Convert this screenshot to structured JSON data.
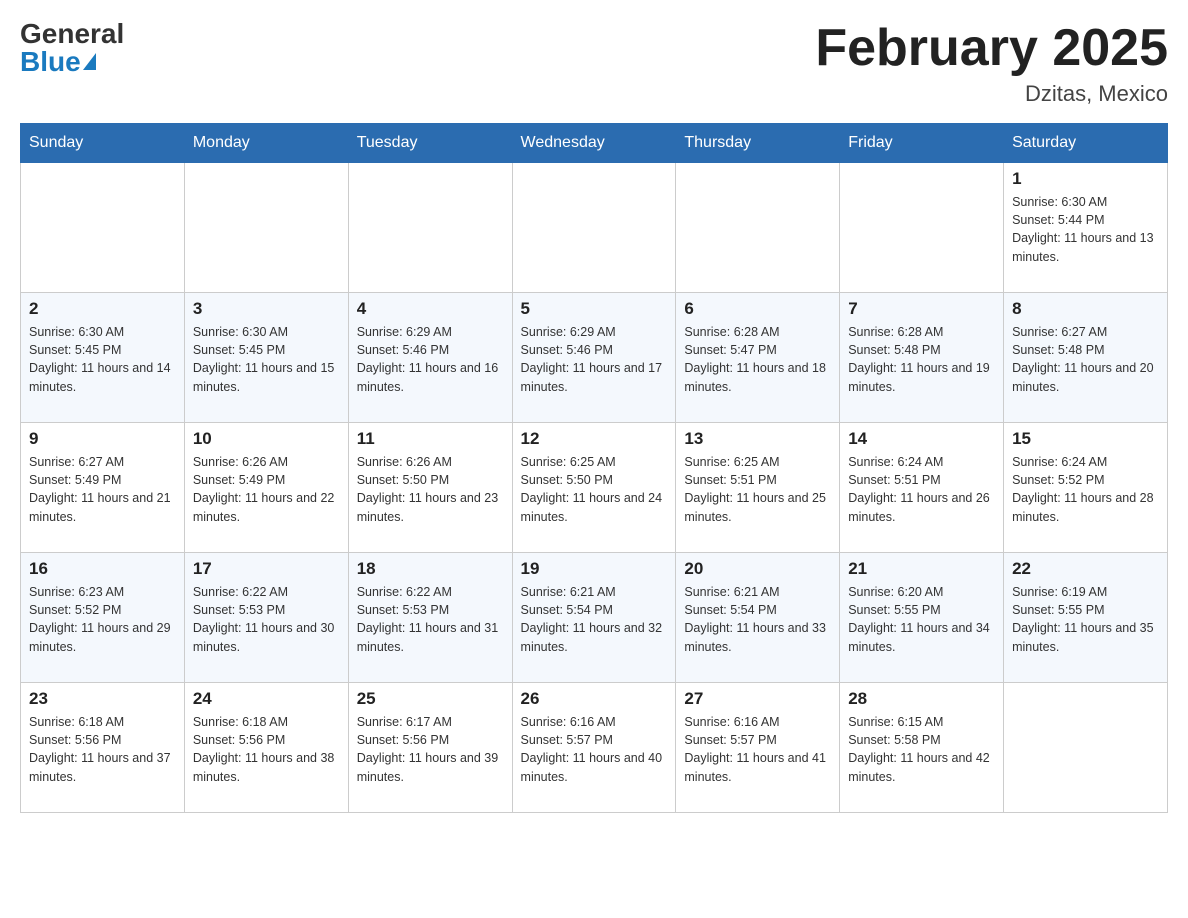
{
  "header": {
    "logo_general": "General",
    "logo_blue": "Blue",
    "month_year": "February 2025",
    "location": "Dzitas, Mexico"
  },
  "days_of_week": [
    "Sunday",
    "Monday",
    "Tuesday",
    "Wednesday",
    "Thursday",
    "Friday",
    "Saturday"
  ],
  "weeks": [
    [
      {
        "day": "",
        "info": ""
      },
      {
        "day": "",
        "info": ""
      },
      {
        "day": "",
        "info": ""
      },
      {
        "day": "",
        "info": ""
      },
      {
        "day": "",
        "info": ""
      },
      {
        "day": "",
        "info": ""
      },
      {
        "day": "1",
        "info": "Sunrise: 6:30 AM\nSunset: 5:44 PM\nDaylight: 11 hours and 13 minutes."
      }
    ],
    [
      {
        "day": "2",
        "info": "Sunrise: 6:30 AM\nSunset: 5:45 PM\nDaylight: 11 hours and 14 minutes."
      },
      {
        "day": "3",
        "info": "Sunrise: 6:30 AM\nSunset: 5:45 PM\nDaylight: 11 hours and 15 minutes."
      },
      {
        "day": "4",
        "info": "Sunrise: 6:29 AM\nSunset: 5:46 PM\nDaylight: 11 hours and 16 minutes."
      },
      {
        "day": "5",
        "info": "Sunrise: 6:29 AM\nSunset: 5:46 PM\nDaylight: 11 hours and 17 minutes."
      },
      {
        "day": "6",
        "info": "Sunrise: 6:28 AM\nSunset: 5:47 PM\nDaylight: 11 hours and 18 minutes."
      },
      {
        "day": "7",
        "info": "Sunrise: 6:28 AM\nSunset: 5:48 PM\nDaylight: 11 hours and 19 minutes."
      },
      {
        "day": "8",
        "info": "Sunrise: 6:27 AM\nSunset: 5:48 PM\nDaylight: 11 hours and 20 minutes."
      }
    ],
    [
      {
        "day": "9",
        "info": "Sunrise: 6:27 AM\nSunset: 5:49 PM\nDaylight: 11 hours and 21 minutes."
      },
      {
        "day": "10",
        "info": "Sunrise: 6:26 AM\nSunset: 5:49 PM\nDaylight: 11 hours and 22 minutes."
      },
      {
        "day": "11",
        "info": "Sunrise: 6:26 AM\nSunset: 5:50 PM\nDaylight: 11 hours and 23 minutes."
      },
      {
        "day": "12",
        "info": "Sunrise: 6:25 AM\nSunset: 5:50 PM\nDaylight: 11 hours and 24 minutes."
      },
      {
        "day": "13",
        "info": "Sunrise: 6:25 AM\nSunset: 5:51 PM\nDaylight: 11 hours and 25 minutes."
      },
      {
        "day": "14",
        "info": "Sunrise: 6:24 AM\nSunset: 5:51 PM\nDaylight: 11 hours and 26 minutes."
      },
      {
        "day": "15",
        "info": "Sunrise: 6:24 AM\nSunset: 5:52 PM\nDaylight: 11 hours and 28 minutes."
      }
    ],
    [
      {
        "day": "16",
        "info": "Sunrise: 6:23 AM\nSunset: 5:52 PM\nDaylight: 11 hours and 29 minutes."
      },
      {
        "day": "17",
        "info": "Sunrise: 6:22 AM\nSunset: 5:53 PM\nDaylight: 11 hours and 30 minutes."
      },
      {
        "day": "18",
        "info": "Sunrise: 6:22 AM\nSunset: 5:53 PM\nDaylight: 11 hours and 31 minutes."
      },
      {
        "day": "19",
        "info": "Sunrise: 6:21 AM\nSunset: 5:54 PM\nDaylight: 11 hours and 32 minutes."
      },
      {
        "day": "20",
        "info": "Sunrise: 6:21 AM\nSunset: 5:54 PM\nDaylight: 11 hours and 33 minutes."
      },
      {
        "day": "21",
        "info": "Sunrise: 6:20 AM\nSunset: 5:55 PM\nDaylight: 11 hours and 34 minutes."
      },
      {
        "day": "22",
        "info": "Sunrise: 6:19 AM\nSunset: 5:55 PM\nDaylight: 11 hours and 35 minutes."
      }
    ],
    [
      {
        "day": "23",
        "info": "Sunrise: 6:18 AM\nSunset: 5:56 PM\nDaylight: 11 hours and 37 minutes."
      },
      {
        "day": "24",
        "info": "Sunrise: 6:18 AM\nSunset: 5:56 PM\nDaylight: 11 hours and 38 minutes."
      },
      {
        "day": "25",
        "info": "Sunrise: 6:17 AM\nSunset: 5:56 PM\nDaylight: 11 hours and 39 minutes."
      },
      {
        "day": "26",
        "info": "Sunrise: 6:16 AM\nSunset: 5:57 PM\nDaylight: 11 hours and 40 minutes."
      },
      {
        "day": "27",
        "info": "Sunrise: 6:16 AM\nSunset: 5:57 PM\nDaylight: 11 hours and 41 minutes."
      },
      {
        "day": "28",
        "info": "Sunrise: 6:15 AM\nSunset: 5:58 PM\nDaylight: 11 hours and 42 minutes."
      },
      {
        "day": "",
        "info": ""
      }
    ]
  ]
}
